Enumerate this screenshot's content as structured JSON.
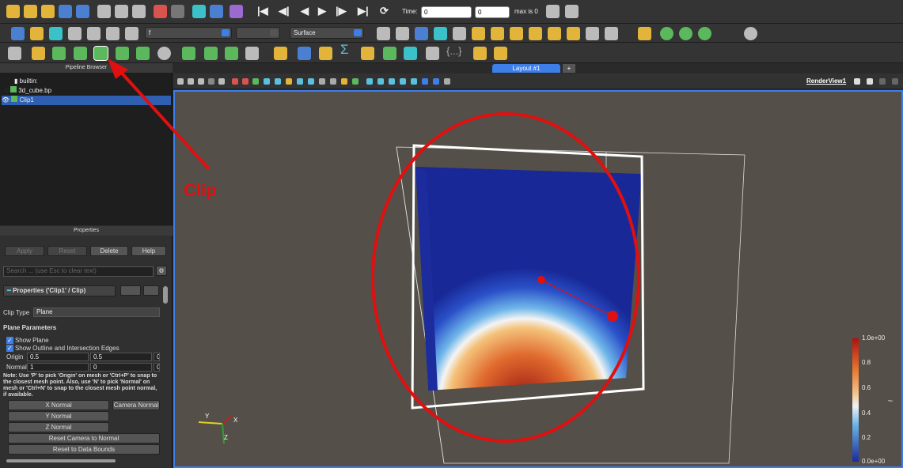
{
  "toolbar1": {
    "time_label": "Time:",
    "time_value": "0",
    "step_value": "0",
    "max_label": "max is 0"
  },
  "toolbar2": {
    "array_select": "f",
    "representation": "Surface"
  },
  "pipeline": {
    "title": "Pipeline Browser",
    "items": [
      "builtin:",
      "3d_cube.bp",
      "Clip1"
    ]
  },
  "annotation": {
    "label": "Clip",
    "color": "#e01010"
  },
  "layout_tab": "Layout #1",
  "layout_add": "+",
  "render_view": "RenderView1",
  "properties": {
    "title": "Properties",
    "apply": "Apply",
    "reset": "Reset",
    "delete": "Delete",
    "help": "Help",
    "search_placeholder": "Search ... (use Esc to clear text)",
    "section": "Properties ('Clip1' / Clip)",
    "clip_type_label": "Clip Type",
    "clip_type_value": "Plane",
    "plane_params": "Plane Parameters",
    "show_plane": "Show Plane",
    "show_outline": "Show Outline and Intersection Edges",
    "origin_label": "Origin",
    "origin": [
      "0.5",
      "0.5",
      "0.5"
    ],
    "normal_label": "Normal",
    "normal": [
      "1",
      "0",
      "0"
    ],
    "note": "Note: Use 'P' to pick 'Origin' on mesh or 'Ctrl+P' to snap to the closest mesh point. Also, use 'N' to pick 'Normal' on mesh or 'Ctrl+N' to snap to the closest mesh point normal, if available.",
    "x_normal": "X Normal",
    "y_normal": "Y Normal",
    "z_normal": "Z Normal",
    "camera_normal": "Camera Normal",
    "reset_camera": "Reset Camera to Normal",
    "reset_bounds": "Reset to Data Bounds"
  },
  "colorbar": {
    "labels": [
      "1.0e+00",
      "0.8",
      "0.6",
      "0.4",
      "0.2",
      "0.0e+00"
    ],
    "title": "f"
  },
  "axes": {
    "x": "X",
    "y": "Y",
    "z": "Z"
  }
}
